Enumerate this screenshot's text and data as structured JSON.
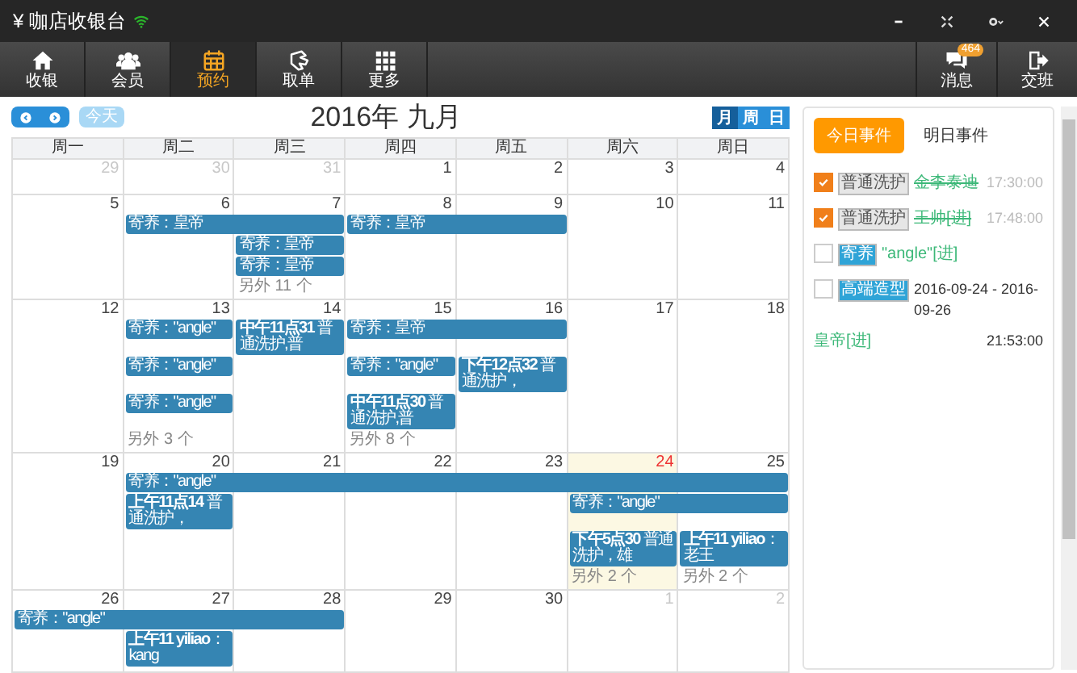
{
  "window": {
    "title": "¥ 咖店收银台"
  },
  "nav": {
    "left": [
      {
        "label": "收银",
        "selected": false
      },
      {
        "label": "会员",
        "selected": false
      },
      {
        "label": "预约",
        "selected": true
      },
      {
        "label": "取单",
        "selected": false
      },
      {
        "label": "更多",
        "selected": false
      }
    ],
    "right": [
      {
        "label": "消息",
        "badge": "464"
      },
      {
        "label": "交班"
      }
    ]
  },
  "calendar": {
    "today_button": {
      "label": "今天",
      "disabled": true
    },
    "title": "2016年 九月",
    "views": [
      {
        "label": "月",
        "selected": true
      },
      {
        "label": "周",
        "selected": false
      },
      {
        "label": "日",
        "selected": false
      }
    ],
    "weekdays": [
      "周一",
      "周二",
      "周三",
      "周四",
      "周五",
      "周六",
      "周日"
    ],
    "weeks": [
      {
        "days": [
          {
            "num": "29",
            "kind": "other"
          },
          {
            "num": "30",
            "kind": "other"
          },
          {
            "num": "31",
            "kind": "other"
          },
          {
            "num": "1",
            "kind": "current"
          },
          {
            "num": "2",
            "kind": "current"
          },
          {
            "num": "3",
            "kind": "current"
          },
          {
            "num": "4",
            "kind": "current"
          }
        ]
      },
      {
        "days": [
          {
            "num": "5",
            "kind": "current"
          },
          {
            "num": "6",
            "kind": "current",
            "events": [
              {
                "kind": "event",
                "text": "寄养：皇帝"
              }
            ]
          },
          {
            "num": "7",
            "kind": "current",
            "events": [
              {
                "kind": "cont"
              },
              {
                "kind": "event",
                "text": "寄养：皇帝"
              },
              {
                "kind": "event",
                "text": "寄养：皇帝"
              }
            ],
            "more": "另外 11 个"
          },
          {
            "num": "8",
            "kind": "current",
            "events": [
              {
                "kind": "event",
                "text": "寄养：皇帝"
              }
            ]
          },
          {
            "num": "9",
            "kind": "current",
            "events": [
              {
                "kind": "cont"
              }
            ]
          },
          {
            "num": "10",
            "kind": "current"
          },
          {
            "num": "11",
            "kind": "current"
          }
        ]
      },
      {
        "days": [
          {
            "num": "12",
            "kind": "current"
          },
          {
            "num": "13",
            "kind": "current",
            "events": [
              {
                "kind": "event",
                "text": "寄养：\"angle\""
              },
              {
                "kind": "event",
                "text": "寄养：\"angle\""
              },
              {
                "kind": "event",
                "text": "寄养：\"angle\""
              }
            ],
            "more": "另外 3 个"
          },
          {
            "num": "14",
            "kind": "current",
            "events": [
              {
                "kind": "event",
                "text": "**中午11点31** 普通洗护,普"
              }
            ]
          },
          {
            "num": "15",
            "kind": "current",
            "events": [
              {
                "kind": "event",
                "text": "寄养：皇帝"
              },
              {
                "kind": "event",
                "text": "寄养：\"angle\""
              },
              {
                "kind": "event",
                "text": "**中午11点30** 普通洗护,普"
              }
            ],
            "more": "另外 8 个"
          },
          {
            "num": "16",
            "kind": "current",
            "events": [
              {
                "kind": "cont"
              },
              {
                "kind": "event",
                "text": "**下午12点32** 普通洗护，"
              }
            ]
          },
          {
            "num": "17",
            "kind": "current"
          },
          {
            "num": "18",
            "kind": "current"
          }
        ]
      },
      {
        "days": [
          {
            "num": "19",
            "kind": "current"
          },
          {
            "num": "20",
            "kind": "current",
            "events": [
              {
                "kind": "event",
                "text": "寄养：\"angle\""
              },
              {
                "kind": "event",
                "text": "**上午11点14** 普通洗护，"
              }
            ]
          },
          {
            "num": "21",
            "kind": "current",
            "events": [
              {
                "kind": "cont"
              }
            ]
          },
          {
            "num": "22",
            "kind": "current",
            "events": [
              {
                "kind": "cont"
              }
            ]
          },
          {
            "num": "23",
            "kind": "current",
            "events": [
              {
                "kind": "cont"
              }
            ]
          },
          {
            "num": "24",
            "kind": "today",
            "events": [
              {
                "kind": "cont"
              },
              {
                "kind": "event",
                "text": "寄养：\"angle\""
              },
              {
                "kind": "event",
                "text": "**下午5点30** 普通洗护，雄"
              }
            ],
            "more": "另外 2 个"
          },
          {
            "num": "25",
            "kind": "current",
            "events": [
              {
                "kind": "cont"
              },
              {
                "kind": "cont"
              },
              {
                "kind": "event",
                "text": "**上午11 yiliao**：老王"
              }
            ],
            "more": "另外 2 个"
          }
        ]
      },
      {
        "days": [
          {
            "num": "26",
            "kind": "current",
            "events": [
              {
                "kind": "event",
                "text": "寄养：\"angle\""
              }
            ]
          },
          {
            "num": "27",
            "kind": "current",
            "events": [
              {
                "kind": "cont"
              },
              {
                "kind": "event",
                "text": "**上午11 yiliao**：kang"
              }
            ]
          },
          {
            "num": "28",
            "kind": "current",
            "events": [
              {
                "kind": "cont"
              }
            ]
          },
          {
            "num": "29",
            "kind": "current"
          },
          {
            "num": "30",
            "kind": "current"
          },
          {
            "num": "1",
            "kind": "other"
          },
          {
            "num": "2",
            "kind": "other"
          }
        ]
      }
    ]
  },
  "panel": {
    "tabs": [
      {
        "label": "今日事件",
        "selected": true
      },
      {
        "label": "明日事件",
        "selected": false
      }
    ],
    "items": [
      {
        "kind": "task",
        "checked": true,
        "tag": "普通洗护",
        "color": "#e6e6e6",
        "text": "金李泰迪",
        "time": "17:30:00"
      },
      {
        "kind": "task",
        "checked": true,
        "tag": "普通洗护",
        "color": "#e6e6e6",
        "text": "王帅[进]",
        "time": "17:48:00"
      },
      {
        "kind": "task",
        "checked": false,
        "tag": "寄养",
        "color": "#2fa4d7",
        "text": "\"angle\"[进]"
      },
      {
        "kind": "range",
        "checked": false,
        "tag": "高端造型",
        "color": "#2fa4d7",
        "text": "2016-09-24 - 2016-09-26"
      },
      {
        "kind": "note",
        "text": "皇帝[进]",
        "time": "21:53:00"
      }
    ]
  }
}
